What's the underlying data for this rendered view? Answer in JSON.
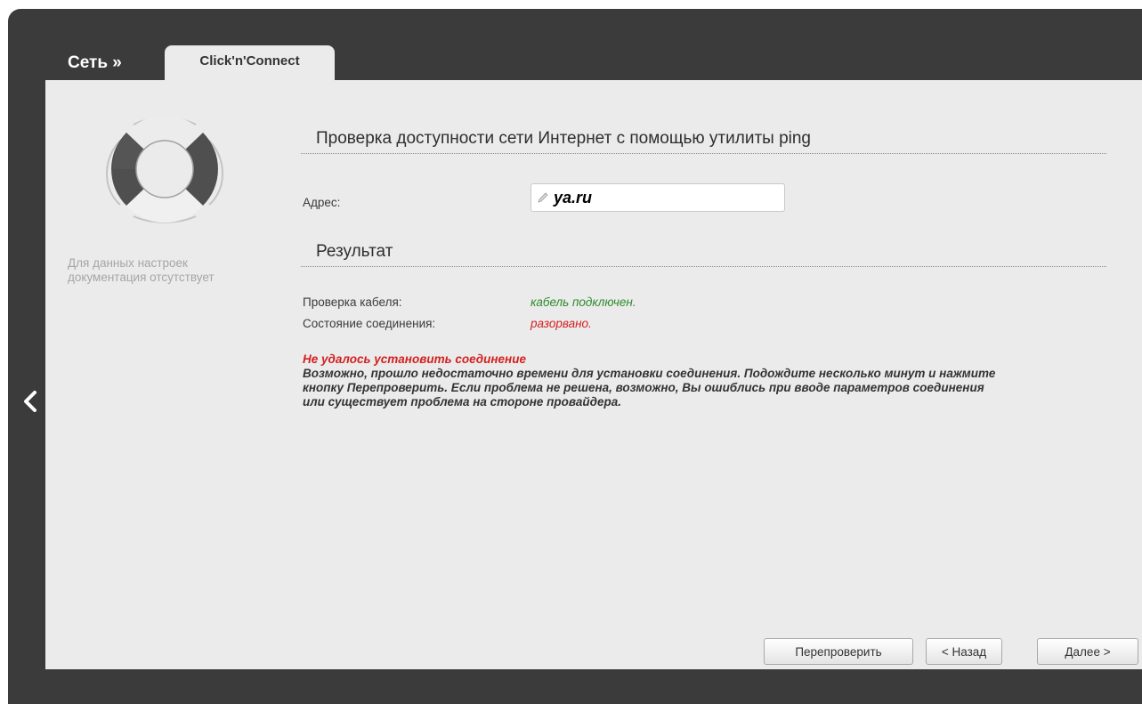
{
  "header": {
    "breadcrumb": "Сеть »",
    "active_tab": "Click'n'Connect"
  },
  "help": {
    "text": "Для данных настроек документация отсутствует",
    "icon": "lifebuoy-icon"
  },
  "ping": {
    "title": "Проверка доступности сети Интернет с помощью утилиты ping",
    "address_label": "Адрес:",
    "address_value": "ya.ru"
  },
  "result": {
    "title": "Результат",
    "cable_label": "Проверка кабеля:",
    "cable_value": "кабель подключен.",
    "connection_label": "Состояние соединения:",
    "connection_value": "разорвано.",
    "error_title": "Не удалось установить соединение",
    "error_text": "Возможно, прошло недостаточно времени для установки соединения. Подождите несколько минут и нажмите кнопку Перепроверить. Если проблема не решена, возможно, Вы ошиблись при вводе параметров соединения или существует проблема на стороне провайдера."
  },
  "buttons": {
    "recheck": "Перепроверить",
    "back": "< Назад",
    "next": "Далее >"
  },
  "colors": {
    "frame": "#3b3b3b",
    "panel": "#ebebeb",
    "ok": "#2e8b2e",
    "error": "#d42020"
  }
}
